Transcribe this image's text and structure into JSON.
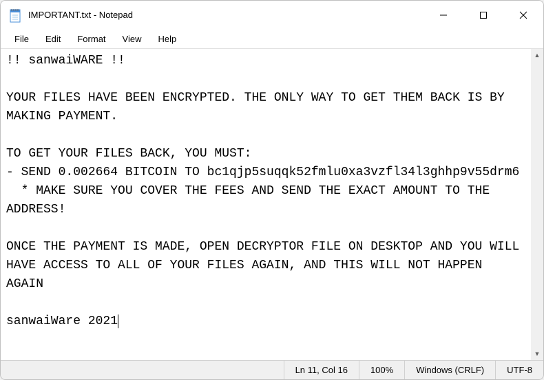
{
  "titlebar": {
    "title": "IMPORTANT.txt - Notepad"
  },
  "menubar": {
    "items": [
      "File",
      "Edit",
      "Format",
      "View",
      "Help"
    ]
  },
  "content": {
    "text": "!! sanwaiWARE !!\n\nYOUR FILES HAVE BEEN ENCRYPTED. THE ONLY WAY TO GET THEM BACK IS BY MAKING PAYMENT.\n\nTO GET YOUR FILES BACK, YOU MUST:\n- SEND 0.002664 BITCOIN TO bc1qjp5suqqk52fmlu0xa3vzfl34l3ghhp9v55drm6\n  * MAKE SURE YOU COVER THE FEES AND SEND THE EXACT AMOUNT TO THE ADDRESS!\n\nONCE THE PAYMENT IS MADE, OPEN DECRYPTOR FILE ON DESKTOP AND YOU WILL HAVE ACCESS TO ALL OF YOUR FILES AGAIN, AND THIS WILL NOT HAPPEN AGAIN\n\nsanwaiWare 2021"
  },
  "statusbar": {
    "position": "Ln 11, Col 16",
    "zoom": "100%",
    "lineEnding": "Windows (CRLF)",
    "encoding": "UTF-8"
  }
}
